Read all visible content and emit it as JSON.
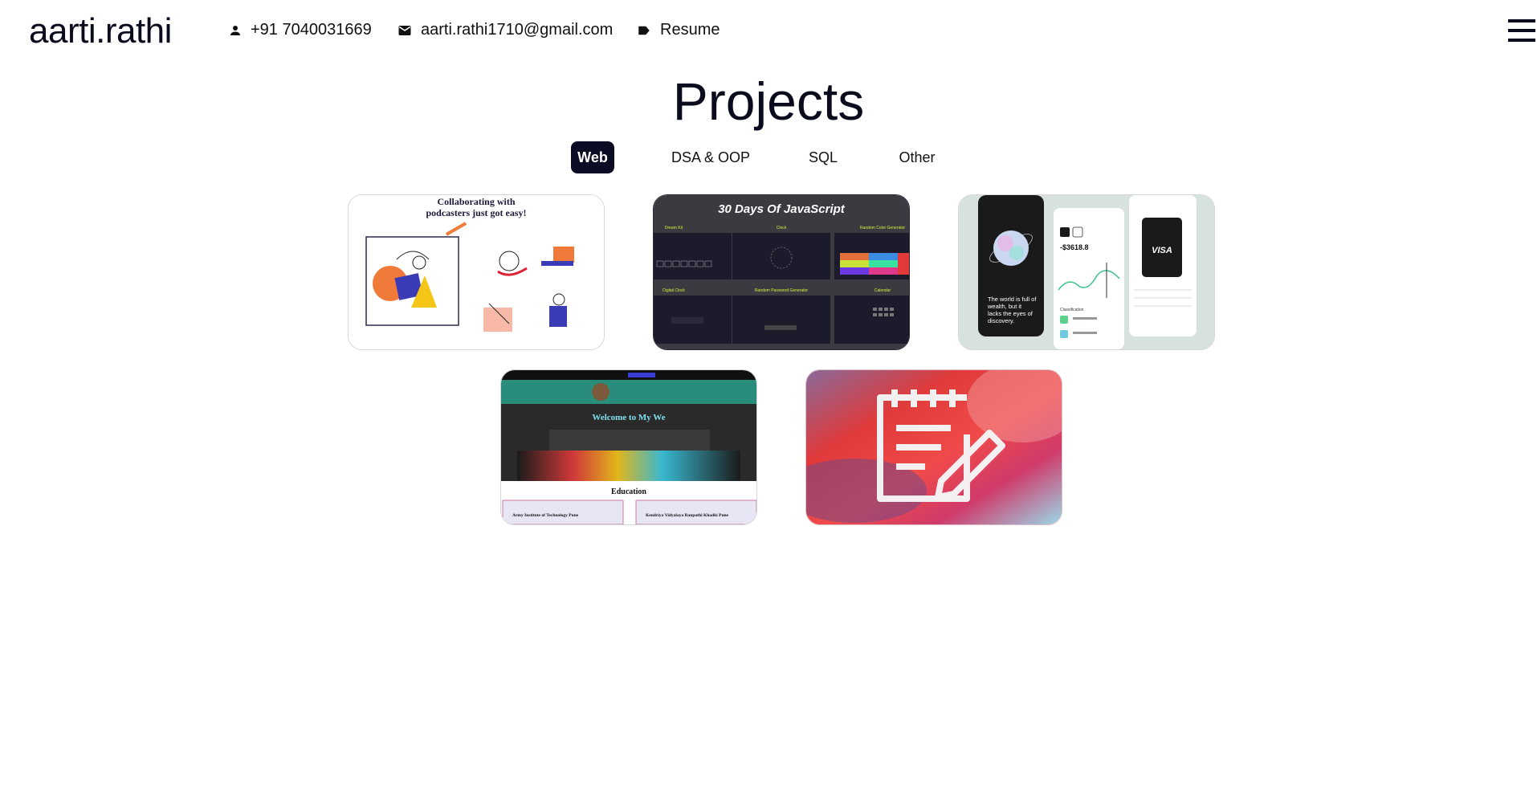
{
  "header": {
    "brand": "aarti.rathi",
    "phone": "+91 7040031669",
    "email": "aarti.rathi1710@gmail.com",
    "resume": "Resume",
    "icons": {
      "phone": "person-icon",
      "email": "mail-icon",
      "resume": "label-icon",
      "menu": "hamburger-menu-icon"
    }
  },
  "page": {
    "title": "Projects"
  },
  "tabs": [
    {
      "label": "Web",
      "active": true
    },
    {
      "label": "DSA & OOP",
      "active": false
    },
    {
      "label": "SQL",
      "active": false
    },
    {
      "label": "Other",
      "active": false
    }
  ],
  "projects": [
    {
      "thumb_text": [
        "Collaborating with",
        "podcasters just got easy!"
      ]
    },
    {
      "thumb_text": [
        "30 Days Of JavaScript",
        "Dream Kit",
        "Clock",
        "Random Color Generator",
        "Digital Clock",
        "Random Password Generator",
        "Calendar"
      ]
    },
    {
      "thumb_text": [
        "The world is full of",
        "wealth, but it",
        "lacks the eyes of",
        "discovery.",
        "-$3618.8",
        "VISA",
        "Classification"
      ]
    },
    {
      "thumb_text": [
        "Welcome to My We",
        "Education",
        "Army Institute of Technology Pune",
        "Kendriya Vidyalaya Ranpathi Khadki Pune"
      ]
    },
    {
      "thumb_text": []
    }
  ],
  "colors": {
    "accent": "#0b0b24",
    "text": "#0b0b1e"
  }
}
